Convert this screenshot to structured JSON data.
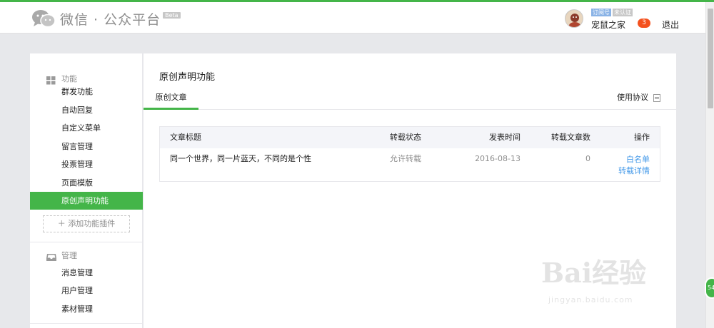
{
  "header": {
    "brand": "微信 · 公众平台",
    "beta": "Beta",
    "tags": [
      "订阅号",
      "未认证"
    ],
    "account_name": "宠鼠之家",
    "notification_count": "3",
    "logout": "退出"
  },
  "sidebar": {
    "groups": [
      {
        "label": "功能",
        "icon": "grid-icon",
        "items": [
          "群发功能",
          "自动回复",
          "自定义菜单",
          "留言管理",
          "投票管理",
          "页面模版",
          "原创声明功能"
        ],
        "active_item": "原创声明功能",
        "add_plugin": "添加功能插件"
      },
      {
        "label": "管理",
        "icon": "inbox-icon",
        "items": [
          "消息管理",
          "用户管理",
          "素材管理"
        ]
      }
    ]
  },
  "main": {
    "title": "原创声明功能",
    "tabs": [
      {
        "label": "原创文章",
        "active": true
      }
    ],
    "agreement_link": "使用协议",
    "table": {
      "columns": [
        "文章标题",
        "转载状态",
        "发表时间",
        "转载文章数",
        "操作"
      ],
      "rows": [
        {
          "title": "同一个世界，同一片蓝天，不同的是个性",
          "status": "允许转载",
          "date": "2016-08-13",
          "count": "0",
          "actions": [
            "白名单",
            "转载详情"
          ]
        }
      ]
    }
  },
  "watermark": {
    "text": "Bai经验",
    "sub": "jingyan.baidu.com"
  },
  "float_button": "54",
  "colors": {
    "accent": "#44b549",
    "link": "#459ae9",
    "badge": "#f4511e",
    "background": "#e7e8eb"
  }
}
